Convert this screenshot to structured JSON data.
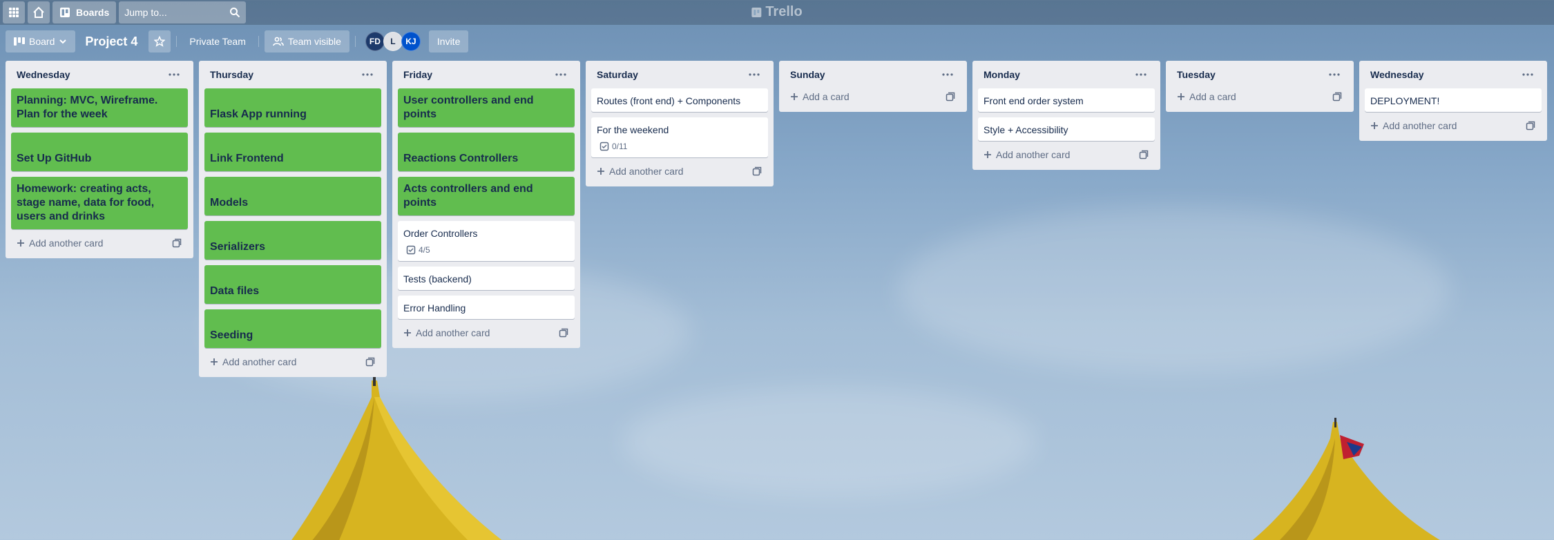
{
  "app": {
    "logo_text": "Trello"
  },
  "topbar": {
    "boards_label": "Boards",
    "search_placeholder": "Jump to..."
  },
  "board": {
    "view_label": "Board",
    "title": "Project 4",
    "team_label": "Private Team",
    "visibility_label": "Team visible",
    "invite_label": "Invite",
    "members": [
      {
        "initials": "FD",
        "color": "#1d3a6b"
      },
      {
        "initials": "L",
        "color": "#dfe1e6"
      },
      {
        "initials": "KJ",
        "color": "#0052cc"
      }
    ]
  },
  "lists": [
    {
      "title": "Wednesday",
      "cards": [
        {
          "text": "Planning: MVC, Wireframe. Plan for the week",
          "style": "green"
        },
        {
          "text": "Set Up GitHub",
          "style": "green"
        },
        {
          "text": "Homework: creating acts, stage name, data for food, users and drinks",
          "style": "green"
        }
      ],
      "add_label": "Add another card"
    },
    {
      "title": "Thursday",
      "cards": [
        {
          "text": "Flask App running",
          "style": "green"
        },
        {
          "text": "Link Frontend",
          "style": "green"
        },
        {
          "text": "Models",
          "style": "green"
        },
        {
          "text": "Serializers",
          "style": "green"
        },
        {
          "text": "Data files",
          "style": "green"
        },
        {
          "text": "Seeding",
          "style": "green"
        }
      ],
      "add_label": "Add another card"
    },
    {
      "title": "Friday",
      "cards": [
        {
          "text": "User controllers and end points",
          "style": "green"
        },
        {
          "text": "Reactions Controllers",
          "style": "green"
        },
        {
          "text": "Acts controllers and end points",
          "style": "green"
        },
        {
          "text": "Order Controllers",
          "style": "plain",
          "checklist": "4/5"
        },
        {
          "text": "Tests (backend)",
          "style": "plain"
        },
        {
          "text": "Error Handling",
          "style": "plain"
        }
      ],
      "add_label": "Add another card"
    },
    {
      "title": "Saturday",
      "cards": [
        {
          "text": "Routes (front end) + Components",
          "style": "plain"
        },
        {
          "text": "For the weekend",
          "style": "plain",
          "checklist": "0/11"
        }
      ],
      "add_label": "Add another card"
    },
    {
      "title": "Sunday",
      "cards": [],
      "add_label": "Add a card"
    },
    {
      "title": "Monday",
      "cards": [
        {
          "text": "Front end order system",
          "style": "plain"
        },
        {
          "text": "Style + Accessibility",
          "style": "plain"
        }
      ],
      "add_label": "Add another card"
    },
    {
      "title": "Tuesday",
      "cards": [],
      "add_label": "Add a card"
    },
    {
      "title": "Wednesday",
      "cards": [
        {
          "text": "DEPLOYMENT!",
          "style": "plain"
        }
      ],
      "add_label": "Add another card"
    }
  ]
}
